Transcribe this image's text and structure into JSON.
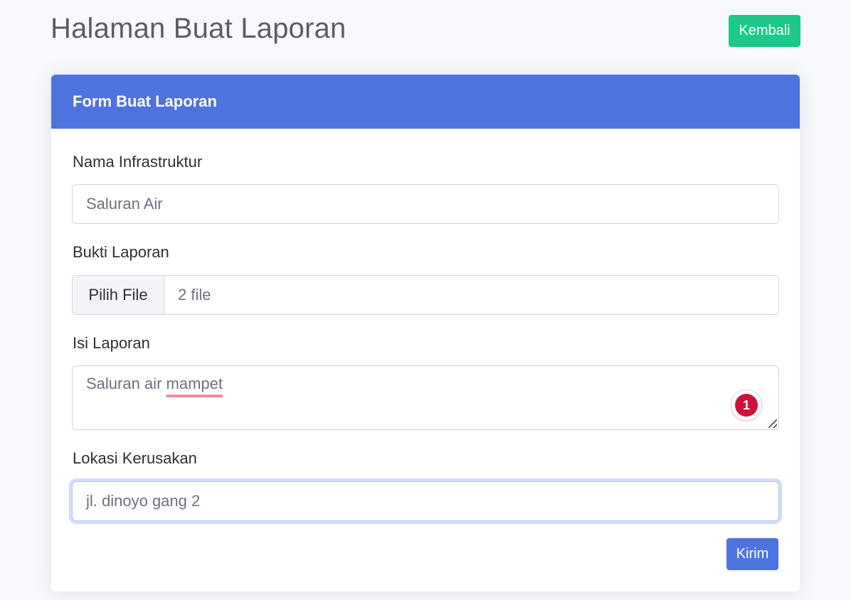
{
  "header": {
    "title": "Halaman Buat Laporan",
    "back_label": "Kembali"
  },
  "form": {
    "title": "Form Buat Laporan",
    "infrastructure": {
      "label": "Nama Infrastruktur",
      "value": "Saluran Air"
    },
    "evidence": {
      "label": "Bukti Laporan",
      "button": "Pilih File",
      "status": "2 file"
    },
    "report": {
      "label": "Isi Laporan",
      "text_before": "Saluran air ",
      "misspelled": "mampet",
      "issues_count": "1"
    },
    "location": {
      "label": "Lokasi Kerusakan",
      "value": "jl. dinoyo gang 2"
    },
    "submit_label": "Kirim"
  },
  "colors": {
    "primary": "#4e73df",
    "success": "#1cc88a",
    "background": "#f8f9fc",
    "grammar_badge": "#d0103a"
  }
}
